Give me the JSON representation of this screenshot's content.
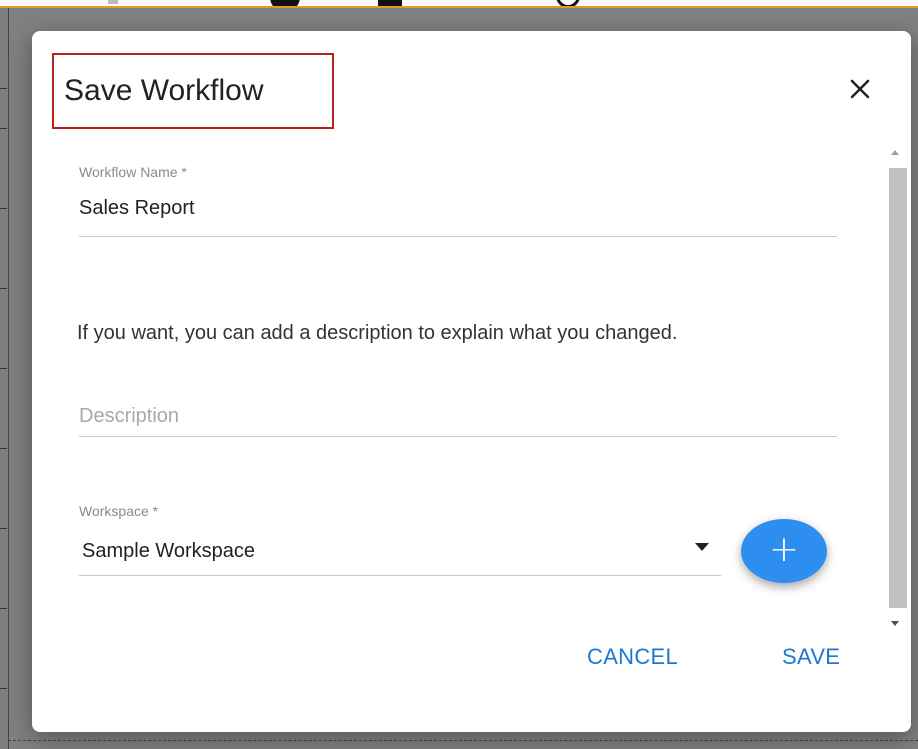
{
  "dialog": {
    "title": "Save Workflow",
    "close_icon": "close-icon"
  },
  "form": {
    "workflow_name": {
      "label": "Workflow Name *",
      "value": "Sales Report"
    },
    "info_text": "If you want, you can add a description to explain what you changed.",
    "description": {
      "placeholder": "Description",
      "value": ""
    },
    "workspace": {
      "label": "Workspace *",
      "selected": "Sample Workspace",
      "dropdown_icon": "caret-down-icon",
      "add_icon": "plus-icon"
    }
  },
  "actions": {
    "cancel_label": "CANCEL",
    "save_label": "SAVE"
  },
  "colors": {
    "accent": "#2e8ef0",
    "button_text": "#1e78d2",
    "highlight_border": "#b22222",
    "top_bar_accent": "#e39a2d"
  }
}
